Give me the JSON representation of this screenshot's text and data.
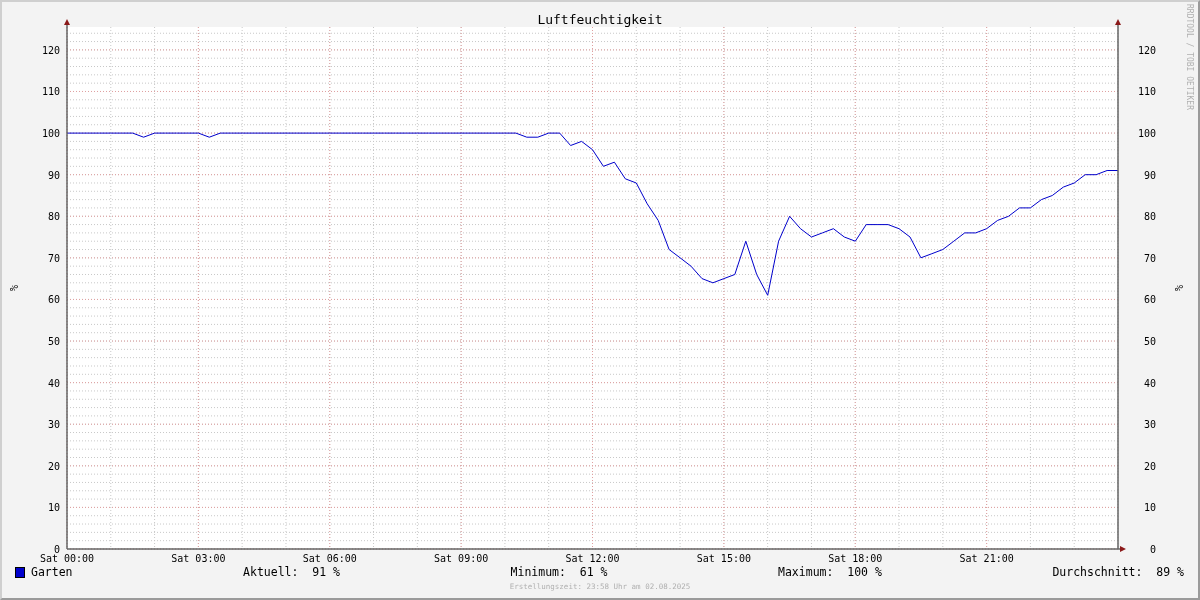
{
  "chart": {
    "chart_data": {
      "type": "line",
      "title": "Luftfeuchtigkeit",
      "ylabel": "%",
      "grid": true,
      "ylim": [
        0,
        125.5
      ],
      "categories": [
        "Sat 00:00",
        null,
        null,
        null,
        null,
        null,
        null,
        null,
        null,
        null,
        null,
        null,
        "Sat 03:00",
        null,
        null,
        null,
        null,
        null,
        null,
        null,
        null,
        null,
        null,
        null,
        "Sat 06:00",
        null,
        null,
        null,
        null,
        null,
        null,
        null,
        null,
        null,
        null,
        null,
        "Sat 09:00",
        null,
        null,
        null,
        null,
        null,
        null,
        null,
        null,
        null,
        null,
        null,
        "Sat 12:00",
        null,
        null,
        null,
        null,
        null,
        null,
        null,
        null,
        null,
        null,
        null,
        "Sat 15:00",
        null,
        null,
        null,
        null,
        null,
        null,
        null,
        null,
        null,
        null,
        null,
        "Sat 18:00",
        null,
        null,
        null,
        null,
        null,
        null,
        null,
        null,
        null,
        null,
        null,
        "Sat 21:00",
        null,
        null,
        null,
        null,
        null,
        null,
        null,
        null,
        null,
        null,
        null,
        null
      ],
      "yticks": [
        0,
        10,
        20,
        30,
        40,
        50,
        60,
        70,
        80,
        90,
        100,
        110,
        120
      ],
      "series": [
        {
          "name": "Garten",
          "color": "#0000cc",
          "values": [
            100,
            100,
            100,
            100,
            100,
            100,
            100,
            99,
            100,
            100,
            100,
            100,
            100,
            99,
            100,
            100,
            100,
            100,
            100,
            100,
            100,
            100,
            100,
            100,
            100,
            100,
            100,
            100,
            100,
            100,
            100,
            100,
            100,
            100,
            100,
            100,
            100,
            100,
            100,
            100,
            100,
            100,
            99,
            99,
            100,
            100,
            97,
            98,
            96,
            92,
            93,
            89,
            88,
            83,
            79,
            72,
            70,
            68,
            65,
            64,
            65,
            66,
            74,
            66,
            61,
            74,
            80,
            77,
            75,
            76,
            77,
            75,
            74,
            78,
            78,
            78,
            77,
            75,
            70,
            71,
            72,
            74,
            76,
            76,
            77,
            79,
            80,
            82,
            82,
            84,
            85,
            87,
            88,
            90,
            90,
            91,
            91
          ]
        }
      ]
    },
    "right_axis": {
      "label": "%",
      "ticks": [
        "120",
        "110",
        "100",
        "90",
        "80",
        "70",
        "60",
        "50",
        "40",
        "30",
        "20",
        "10",
        "0"
      ]
    }
  },
  "legend": {
    "stats": [
      {
        "label": "Aktuell:",
        "value": "91 %"
      },
      {
        "label": "Minimum:",
        "value": "61 %"
      },
      {
        "label": "Maximum:",
        "value": "100 %"
      },
      {
        "label": "Durchschnitt:",
        "value": "89 %"
      }
    ]
  },
  "footer": "Erstellungszeit: 23:58 Uhr am 02.08.2025",
  "side_text": "RRDTOOL / TOBI OETIKER"
}
